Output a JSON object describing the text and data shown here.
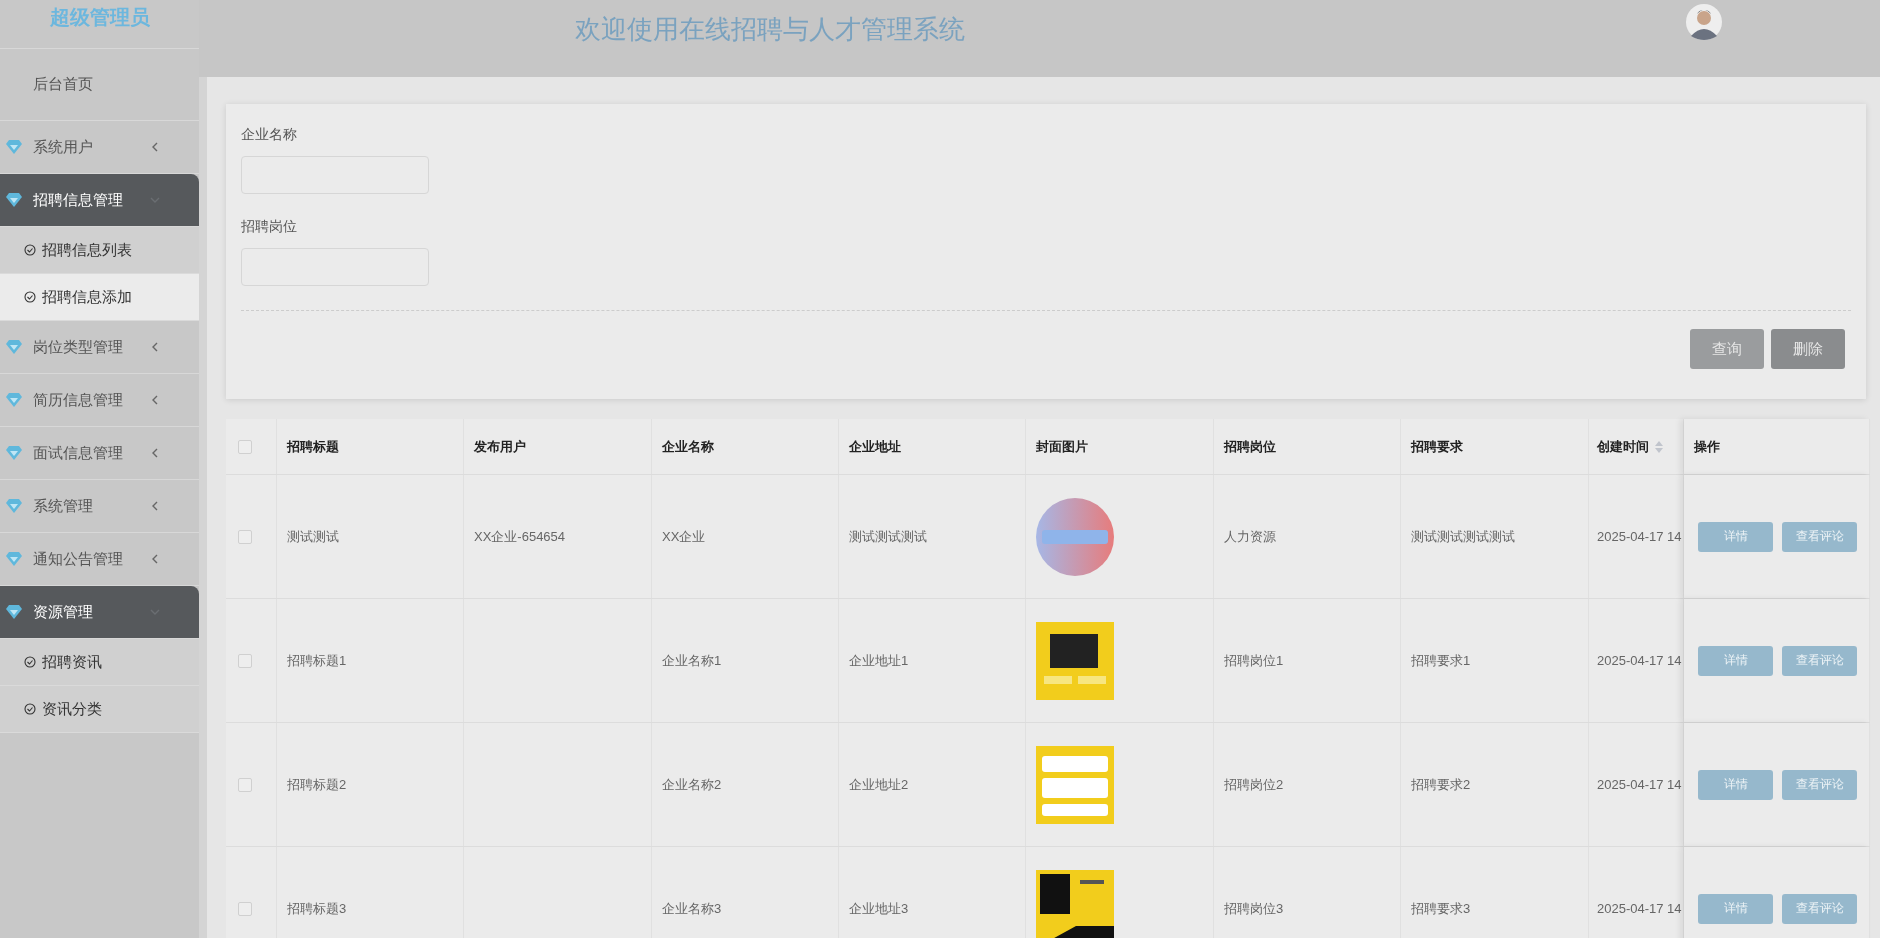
{
  "sidebar": {
    "role": "超级管理员",
    "items": [
      {
        "kind": "link",
        "label": "后台首页"
      },
      {
        "kind": "group",
        "label": "系统用户",
        "expanded": false
      },
      {
        "kind": "group",
        "label": "招聘信息管理",
        "expanded": true,
        "children": [
          {
            "label": "招聘信息列表",
            "selected": false
          },
          {
            "label": "招聘信息添加",
            "selected": true
          }
        ]
      },
      {
        "kind": "group",
        "label": "岗位类型管理",
        "expanded": false
      },
      {
        "kind": "group",
        "label": "简历信息管理",
        "expanded": false
      },
      {
        "kind": "group",
        "label": "面试信息管理",
        "expanded": false
      },
      {
        "kind": "group",
        "label": "系统管理",
        "expanded": false
      },
      {
        "kind": "group",
        "label": "通知公告管理",
        "expanded": false
      },
      {
        "kind": "group",
        "label": "资源管理",
        "expanded": true,
        "children": [
          {
            "label": "招聘资讯",
            "selected": false
          },
          {
            "label": "资讯分类",
            "selected": false
          }
        ]
      }
    ]
  },
  "header": {
    "title": "欢迎使用在线招聘与人才管理系统"
  },
  "search": {
    "fields": [
      {
        "label": "企业名称"
      },
      {
        "label": "招聘岗位"
      }
    ],
    "buttons": [
      "查询",
      "删除"
    ]
  },
  "table": {
    "all_checked": false,
    "columns": [
      "招聘标题",
      "发布用户",
      "企业名称",
      "企业地址",
      "封面图片",
      "招聘岗位",
      "招聘要求",
      "创建时间",
      "操作"
    ],
    "rows": [
      {
        "checked": false,
        "cells": [
          "测试测试",
          "XX企业-654654",
          "XX企业",
          "测试测试测试"
        ],
        "cover": {
          "kind": "picture"
        },
        "cells2": [
          "人力资源",
          "测试测试测试测试",
          "2025-04-17 14"
        ],
        "actions": [
          "详情",
          "查看评论"
        ]
      },
      {
        "checked": false,
        "cells": [
          "招聘标题1",
          "",
          "企业名称1",
          "企业地址1"
        ],
        "cover": {
          "kind": "picture"
        },
        "cells2": [
          "招聘岗位1",
          "招聘要求1",
          "2025-04-17 14"
        ],
        "actions": [
          "详情",
          "查看评论"
        ]
      },
      {
        "checked": false,
        "cells": [
          "招聘标题2",
          "",
          "企业名称2",
          "企业地址2"
        ],
        "cover": {
          "kind": "picture"
        },
        "cells2": [
          "招聘岗位2",
          "招聘要求2",
          "2025-04-17 14"
        ],
        "actions": [
          "详情",
          "查看评论"
        ]
      },
      {
        "checked": false,
        "cells": [
          "招聘标题3",
          "",
          "企业名称3",
          "企业地址3"
        ],
        "cover": {
          "kind": "picture"
        },
        "cells2": [
          "招聘岗位3",
          "招聘要求3",
          "2025-04-17 14"
        ],
        "actions": [
          "详情",
          "查看评论"
        ]
      }
    ]
  }
}
